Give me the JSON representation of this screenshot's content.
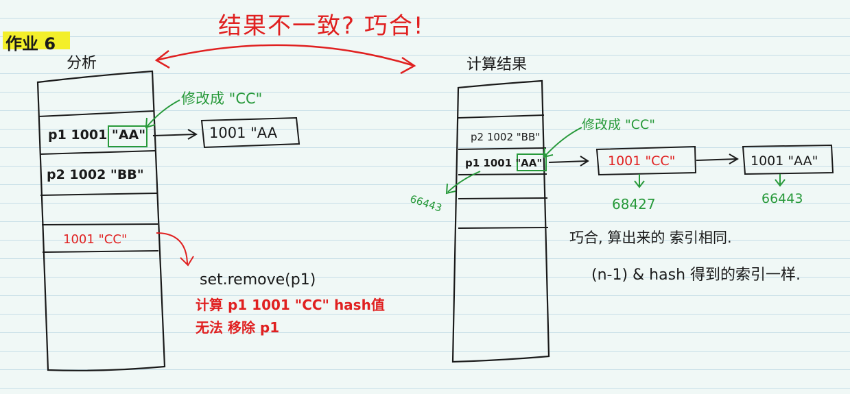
{
  "header": {
    "tag": "作业 6",
    "headline": "结果不一致? 巧合!"
  },
  "left": {
    "title": "分析",
    "row1": "p1  1001 \"AA\"",
    "row2": "p2 1002  \"BB\"",
    "row3": "1001 \"CC\"",
    "modify_label": "修改成 \"CC\"",
    "node": "1001  \"AA",
    "remove_call": "set.remove(p1)",
    "note_line1": "计算  p1  1001 \"CC\" hash值",
    "note_line2": "无法 移除 p1"
  },
  "right": {
    "title": "计算结果",
    "row1": "p2  1002 \"BB\"",
    "row2": "p1  1001 \"AA\"",
    "modify_label": "修改成 \"CC\"",
    "hash_left": "66443",
    "node1": "1001   \"CC\"",
    "node2": "1001   \"AA\"",
    "hash_node1": "68427",
    "hash_node2": "66443",
    "conclusion_line1": "巧合, 算出来的 索引相同.",
    "conclusion_line2": "(n-1) & hash  得到的索引一样."
  },
  "colors": {
    "ink": "#1a1a1a",
    "red": "#e02020",
    "green": "#27993a",
    "highlight": "#f3ef2a",
    "paper": "#f0f8f6",
    "rule": "#c5dde6"
  }
}
